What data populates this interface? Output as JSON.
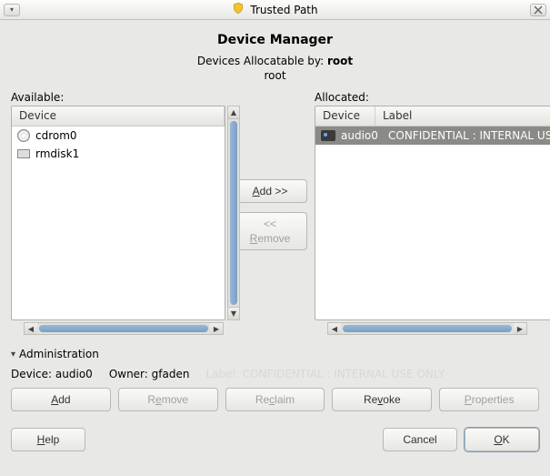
{
  "window": {
    "title": "Trusted Path"
  },
  "page_title": "Device Manager",
  "allocatable_prefix": "Devices Allocatable by: ",
  "allocatable_user": "root",
  "allocatable_line2": "root",
  "available": {
    "label": "Available:",
    "header_device": "Device",
    "items": [
      {
        "icon": "cd",
        "name": "cdrom0"
      },
      {
        "icon": "disk",
        "name": "rmdisk1"
      }
    ]
  },
  "allocated": {
    "label": "Allocated:",
    "header_device": "Device",
    "header_label": "Label",
    "items": [
      {
        "icon": "audio",
        "name": "audio0",
        "device_label": "CONFIDENTIAL : INTERNAL USE ONLY",
        "selected": true
      }
    ]
  },
  "buttons": {
    "add_move": "Add >>",
    "remove_move": "<< Remove"
  },
  "admin": {
    "heading": "Administration",
    "device_label": "Device:",
    "device_value": "audio0",
    "owner_label": "Owner:",
    "owner_value": "gfaden",
    "label_label": "Label:",
    "label_value": "CONFIDENTIAL : INTERNAL USE ONLY",
    "add": "Add",
    "remove": "Remove",
    "reclaim": "Reclaim",
    "revoke": "Revoke",
    "properties": "Properties"
  },
  "footer": {
    "help": "Help",
    "cancel": "Cancel",
    "ok": "OK"
  }
}
